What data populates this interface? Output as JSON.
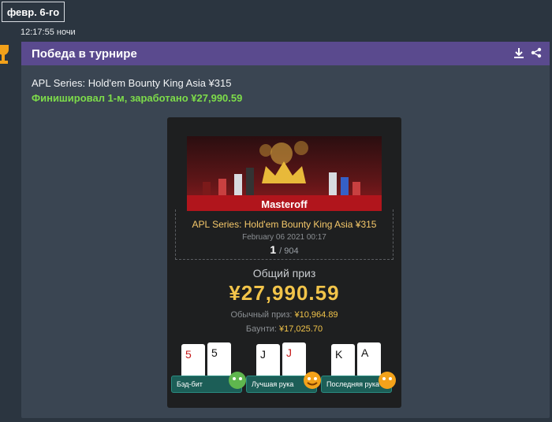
{
  "date_badge": "февр. 6-го",
  "timestamp": "12:17:55 ночи",
  "card": {
    "title": "Победа в турнире",
    "tournament": "APL Series: Hold'em Bounty King Asia ¥315",
    "result": "Финишировал 1-м, заработано ¥27,990.59"
  },
  "panel": {
    "player": "Masteroff",
    "tournament_name": "APL Series: Hold'em Bounty King Asia ¥315",
    "date": "February 06 2021 00:17",
    "place": "1",
    "total": "/ 904",
    "prize_label": "Общий приз",
    "prize_amount": "¥27,990.59",
    "regular_label": "Обычный приз:",
    "regular_value": "¥10,964.89",
    "bounty_label": "Баунти:",
    "bounty_value": "¥17,025.70"
  },
  "achievements": [
    {
      "label": "Бэд-бит",
      "cards": [
        "5",
        "5"
      ]
    },
    {
      "label": "Лучшая рука",
      "cards": [
        "J",
        "J"
      ]
    },
    {
      "label": "Последняя рука",
      "cards": [
        "K",
        "A"
      ]
    }
  ]
}
